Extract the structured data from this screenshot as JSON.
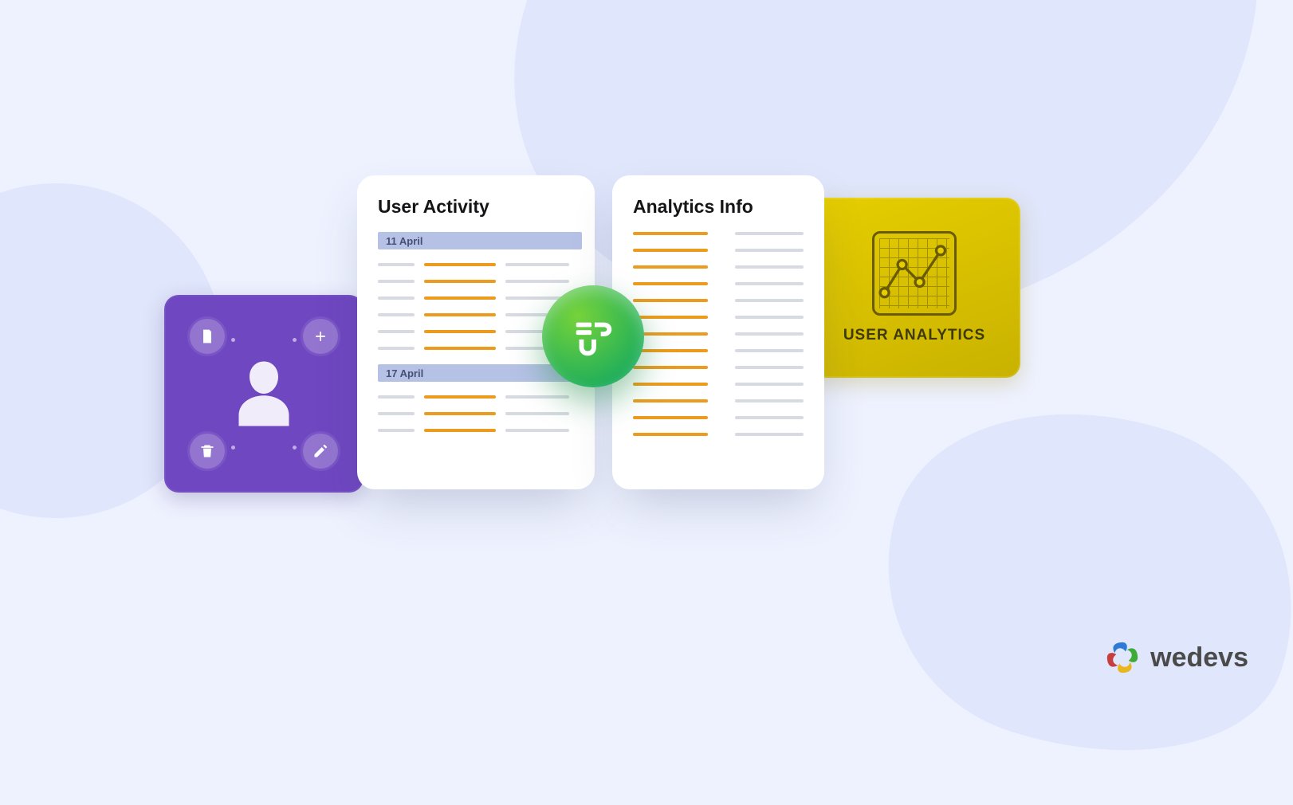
{
  "cards": {
    "user_activity": {
      "title": "User Activity",
      "dates": [
        "11 April",
        "17 April"
      ]
    },
    "analytics_info": {
      "title": "Analytics Info"
    },
    "user_analytics": {
      "label": "USER ANALYTICS"
    }
  },
  "brand": {
    "name": "wedevs"
  },
  "center_badge": {
    "name": "up-logo-icon"
  },
  "left_card_icons": [
    "document-icon",
    "plus-icon",
    "trash-icon",
    "pencil-icon",
    "user-silhouette-icon"
  ],
  "colors": {
    "accent": "#ed9b1f",
    "purple": "#6f47c1",
    "yellow": "#e6ce00",
    "green_gradient": [
      "#76d33a",
      "#1fae5a"
    ]
  }
}
